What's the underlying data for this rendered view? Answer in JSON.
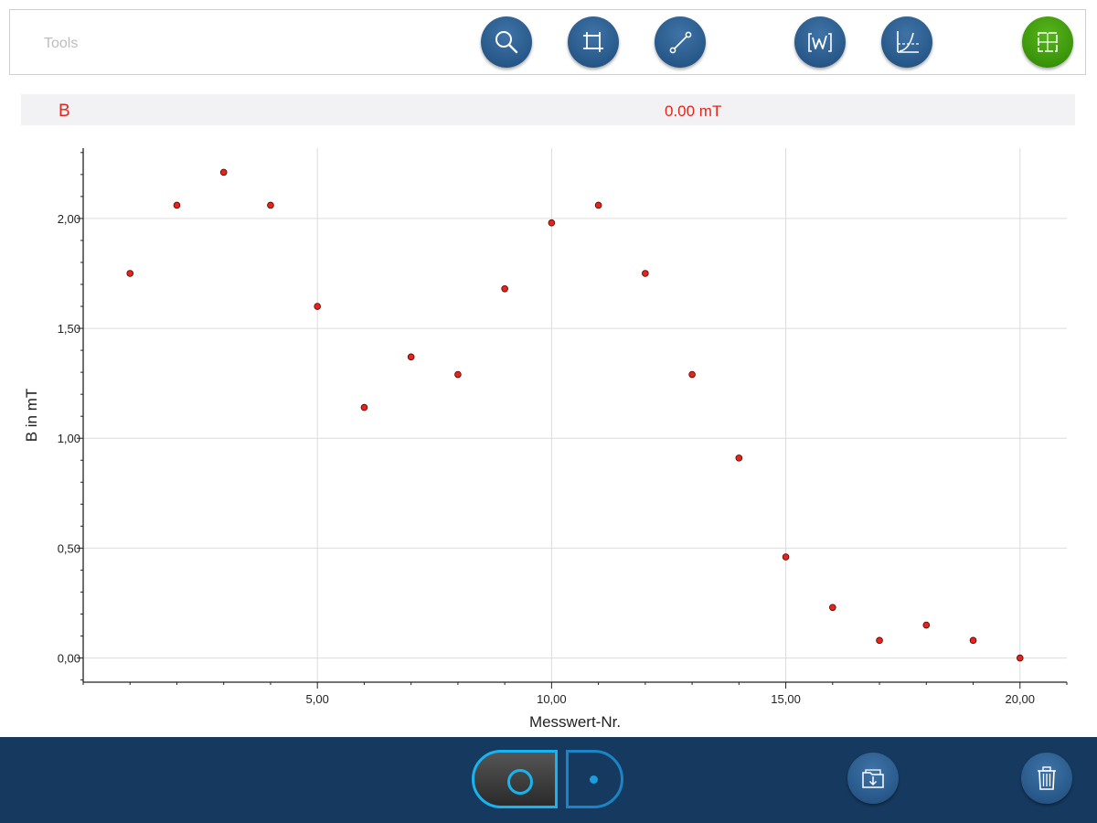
{
  "toolbar": {
    "label": "Tools",
    "buttons": [
      {
        "icon": "zoom-icon"
      },
      {
        "icon": "crop-icon"
      },
      {
        "icon": "line-tool-icon"
      },
      {
        "icon": "autoscale-icon"
      },
      {
        "icon": "curve-fit-icon"
      },
      {
        "icon": "fullscreen-icon",
        "color": "#3e9a0c"
      }
    ]
  },
  "readout": {
    "name": "B",
    "value": "0.00 mT",
    "color": "#e3261c"
  },
  "chart_data": {
    "type": "scatter",
    "title": "",
    "xlabel": "Messwert-Nr.",
    "ylabel": "B in mT",
    "xlim": [
      0,
      21
    ],
    "ylim": [
      -0.11,
      2.32
    ],
    "x_ticks": [
      5,
      10,
      15,
      20
    ],
    "x_tick_labels": [
      "5,00",
      "10,00",
      "15,00",
      "20,00"
    ],
    "y_ticks": [
      0,
      0.5,
      1,
      1.5,
      2
    ],
    "y_tick_labels": [
      "0,00",
      "0,50",
      "1,00",
      "1,50",
      "2,00"
    ],
    "grid": true,
    "marker_color": "#e3261c",
    "series": [
      {
        "x": [
          1,
          2,
          3,
          4,
          5,
          6,
          7,
          8,
          9,
          10,
          11,
          12,
          13,
          14,
          15,
          16,
          17,
          18,
          19,
          20
        ],
        "y": [
          1.75,
          2.06,
          2.21,
          2.06,
          1.6,
          1.14,
          1.37,
          1.29,
          1.68,
          1.98,
          2.06,
          1.75,
          1.29,
          0.91,
          0.46,
          0.23,
          0.08,
          0.15,
          0.08,
          0.0
        ]
      }
    ]
  },
  "bottom": {
    "record_icon": "record-ring-icon",
    "single_icon": "single-point-icon",
    "save_icon": "folder-download-icon",
    "delete_icon": "trash-icon",
    "accent": "#18b4f0",
    "background": "#163a5f"
  }
}
